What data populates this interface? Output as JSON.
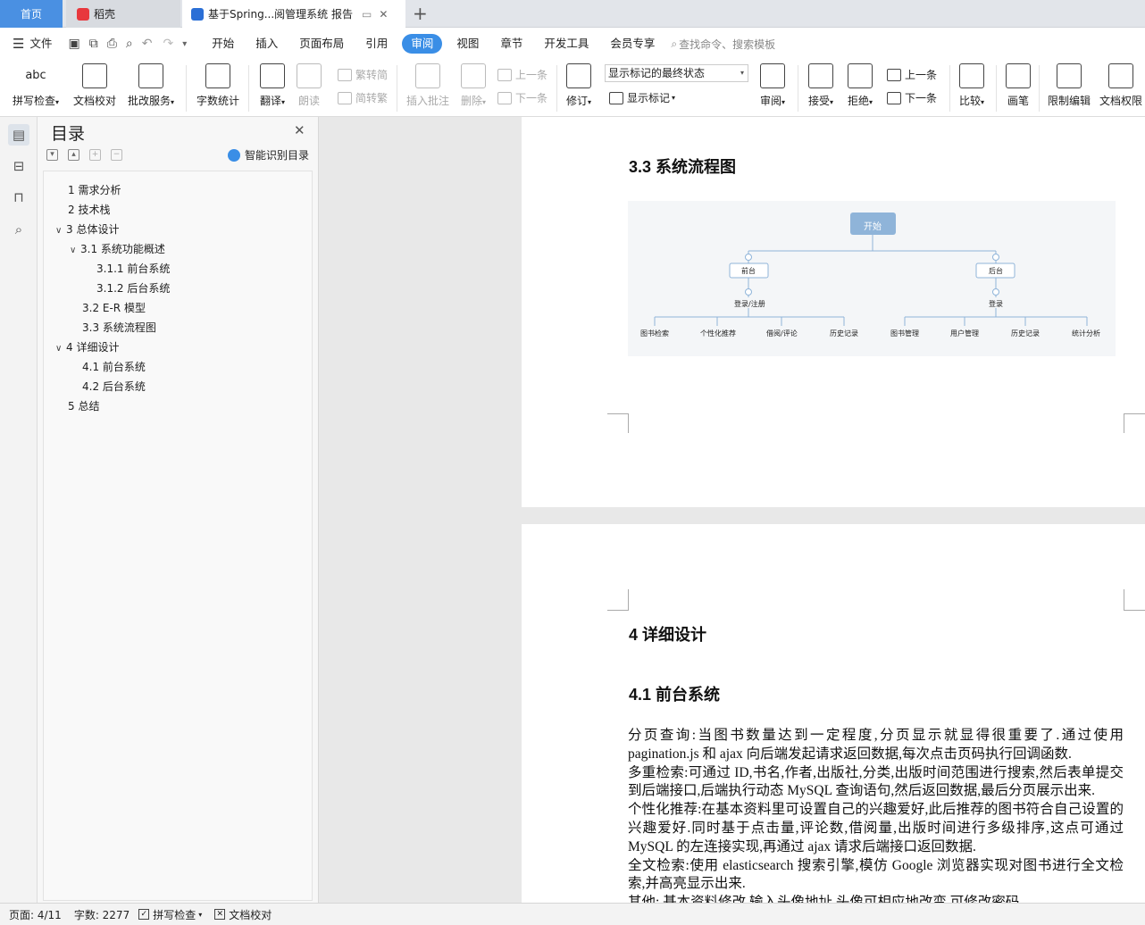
{
  "tabs": {
    "home": "首页",
    "daoke": "稻壳",
    "doc": "基于Spring...阅管理系统 报告"
  },
  "menu": [
    "文件",
    "开始",
    "插入",
    "页面布局",
    "引用",
    "审阅",
    "视图",
    "章节",
    "开发工具",
    "会员专享"
  ],
  "menu_active": "审阅",
  "search_placeholder": "查找命令、搜索模板",
  "ribbon": {
    "spell": "拼写检查",
    "abc": "abc",
    "proof": "文档校对",
    "correct": "批改服务",
    "wordcount": "字数统计",
    "translate": "翻译",
    "read": "朗读",
    "trad2simp": "繁转简",
    "simp2trad": "简转繁",
    "insert_comment": "插入批注",
    "delete": "删除",
    "prev": "上一条",
    "next": "下一条",
    "revise": "修订",
    "markup_state": "显示标记的最终状态",
    "show_markup": "显示标记",
    "review": "审阅",
    "accept": "接受",
    "reject": "拒绝",
    "prev2": "上一条",
    "next2": "下一条",
    "compare": "比较",
    "pen": "画笔",
    "restrict": "限制编辑",
    "doc_perm": "文档权限"
  },
  "toc": {
    "title": "目录",
    "smart": "智能识别目录",
    "items": [
      "1  需求分析",
      "2 技术栈",
      "3  总体设计",
      "3.1  系统功能概述",
      "3.1.1  前台系统",
      "3.1.2  后台系统",
      "3.2 E-R 模型",
      "3.3  系统流程图",
      "4  详细设计",
      "4.1  前台系统",
      "4.2  后台系统",
      "5  总结"
    ]
  },
  "page1": {
    "heading": "3.3  系统流程图"
  },
  "flowchart": {
    "root": "开始",
    "front": "前台",
    "back": "后台",
    "login_reg": "登录/注册",
    "login": "登录",
    "front_leaves": [
      "图书检索",
      "个性化推荐",
      "借阅/评论",
      "历史记录"
    ],
    "back_leaves": [
      "图书管理",
      "用户管理",
      "历史记录",
      "统计分析"
    ]
  },
  "page2": {
    "h1": "4  详细设计",
    "h2": "4.1  前台系统",
    "paragraphs": [
      "分页查询:当图书数量达到一定程度,分页显示就显得很重要了.通过使用pagination.js 和 ajax 向后端发起请求返回数据,每次点击页码执行回调函数.",
      "多重检索:可通过 ID,书名,作者,出版社,分类,出版时间范围进行搜索,然后表单提交到后端接口,后端执行动态 MySQL 查询语句,然后返回数据,最后分页展示出来.",
      "个性化推荐:在基本资料里可设置自己的兴趣爱好,此后推荐的图书符合自己设置的兴趣爱好.同时基于点击量,评论数,借阅量,出版时间进行多级排序,这点可通过MySQL 的左连接实现,再通过 ajax 请求后端接口返回数据.",
      "全文检索:使用 elasticsearch 搜索引擎,模仿 Google 浏览器实现对图书进行全文检索,并高亮显示出来.",
      "其他:  基本资料修改,输入头像地址,头像可相应地改变,可修改密码."
    ]
  },
  "status": {
    "page": "页面: 4/11",
    "words": "字数: 2277",
    "spell": "拼写检查",
    "proof": "文档校对"
  },
  "colors": {
    "accent": "#3a8ee6",
    "flow_node": "#8fb4d9"
  }
}
